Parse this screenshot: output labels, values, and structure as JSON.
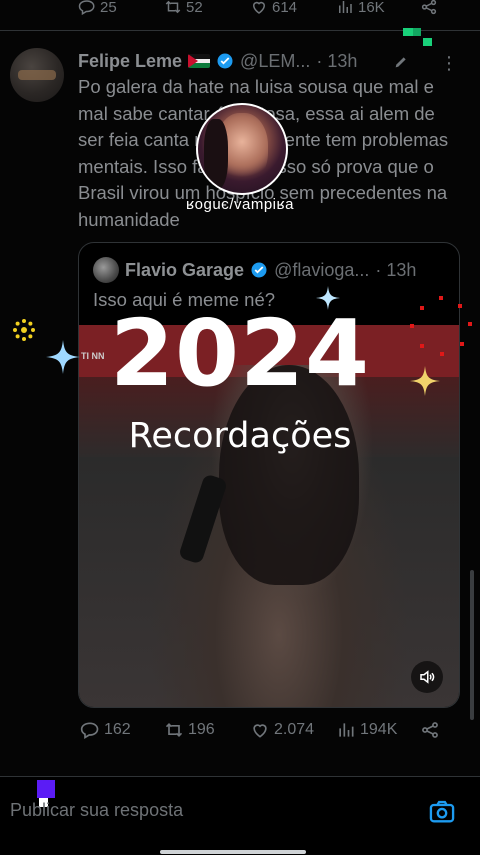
{
  "metrics_top": {
    "replies": "25",
    "retweets": "52",
    "likes": "614",
    "views": "16K"
  },
  "tweet": {
    "name": "Felipe Leme",
    "handle": "@LEM...",
    "time": "· 13h",
    "text": "Po galera da hate na luisa sousa que mal e mal sabe cantar é gostosa, essa ai alem de ser feia canta mal claramente tem problemas mentais. Isso fazer sucesso só prova que o Brasil virou um hospício sem precedentes na humanidade"
  },
  "story": {
    "caption": "ʁoguє/vampiʁa"
  },
  "quote": {
    "name": "Flavio Garage",
    "handle": "@flavioga...",
    "time": "· 13h",
    "text": "Isso aqui é meme né?",
    "media_tag": "TI NN"
  },
  "overlay": {
    "year": "2024",
    "subtitle": "Recordações"
  },
  "actions": {
    "replies": "162",
    "retweets": "196",
    "likes": "2.074",
    "views": "194K"
  },
  "reply_bar": {
    "placeholder": "Publicar sua resposta"
  },
  "colors": {
    "background": "#000000",
    "verified": "#1d9bf0",
    "accent_green": "#19d17a",
    "sparkle_gold": "#f1d36b",
    "sparkle_blue": "#9fd8ff",
    "red_dots": "#e01818"
  }
}
